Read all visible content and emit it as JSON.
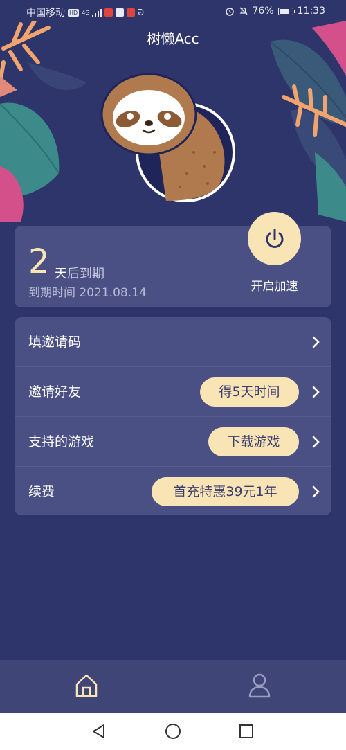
{
  "status_bar": {
    "carrier": "中国移动",
    "hd_badge": "HD",
    "network": "4G",
    "battery_percent": "76%",
    "time": "11:33",
    "battery_fraction": 0.76
  },
  "app": {
    "title": "树懒Acc"
  },
  "expiry": {
    "days": "2",
    "unit_day": "天",
    "unit_rest": "后到期",
    "expiry_text": "到期时间 2021.08.14",
    "accelerate_label": "开启加速"
  },
  "menu": {
    "items": [
      {
        "label": "填邀请码"
      },
      {
        "label": "邀请好友",
        "badge": "得5天时间"
      },
      {
        "label": "支持的游戏",
        "badge": "下载游戏"
      },
      {
        "label": "续费",
        "badge": "首充特惠39元1年"
      }
    ]
  },
  "colors": {
    "background": "#2e356a",
    "card": "#4a5083",
    "accent": "#f9e4b6",
    "bottom_nav": "#3f4577"
  },
  "icons": {
    "power": "power-icon",
    "chevron": "chevron-right-icon",
    "home": "home-icon",
    "user": "user-icon",
    "back": "back-icon",
    "circle": "home-circle-icon",
    "recents": "recents-icon"
  }
}
